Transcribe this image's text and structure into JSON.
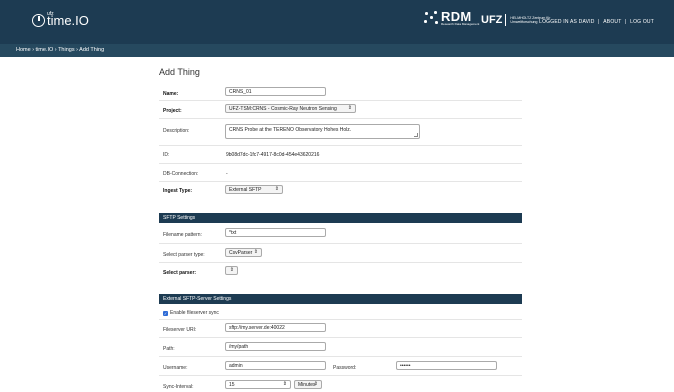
{
  "header": {
    "logo_text": "time.IO",
    "logo_sup": "ufz",
    "rdm_label": "RDM",
    "rdm_sub": "Research Data Management",
    "ufz_label": "UFZ",
    "ufz_sub": "HELMHOLTZ Zentrum für Umweltforschung",
    "logged_in": "LOGGED IN AS DAVID",
    "about": "ABOUT",
    "logout": "LOG OUT",
    "sep": "|"
  },
  "breadcrumb": "Home › time.IO › Things › Add Thing",
  "page_title": "Add Thing",
  "form": {
    "name_label": "Name:",
    "name_value": "CRNS_01",
    "project_label": "Project:",
    "project_value": "UFZ-TSM:CRNS - Cosmic-Ray Neutron Sensing",
    "description_label": "Description:",
    "description_value": "CRNS Probe at the TERENO Observatory Hohes Holz.",
    "id_label": "ID:",
    "id_value": "9b08d7dc-1fc7-4917-8c0d-454e43620216",
    "db_label": "DB-Connection:",
    "db_value": "-",
    "ingest_label": "Ingest Type:",
    "ingest_value": "External SFTP"
  },
  "sftp": {
    "title": "SFTP Settings",
    "filename_label": "Filename pattern:",
    "filename_value": "*txt",
    "parser_type_label": "Select parser type:",
    "parser_type_value": "CsvParser",
    "parser_label": "Select parser:",
    "parser_value": ""
  },
  "external": {
    "title": "External SFTP-Server Settings",
    "sync_label": "Enable fileserver sync",
    "uri_label": "Fileserver URI:",
    "uri_value": "sftp://my.server.de:40022",
    "path_label": "Path:",
    "path_value": "/my/path",
    "username_label": "Username:",
    "username_value": "admin",
    "password_label": "Password:",
    "password_value": "••••••",
    "interval_label": "Sync-Interval:",
    "interval_value": "15",
    "interval_unit": "Minutes"
  }
}
